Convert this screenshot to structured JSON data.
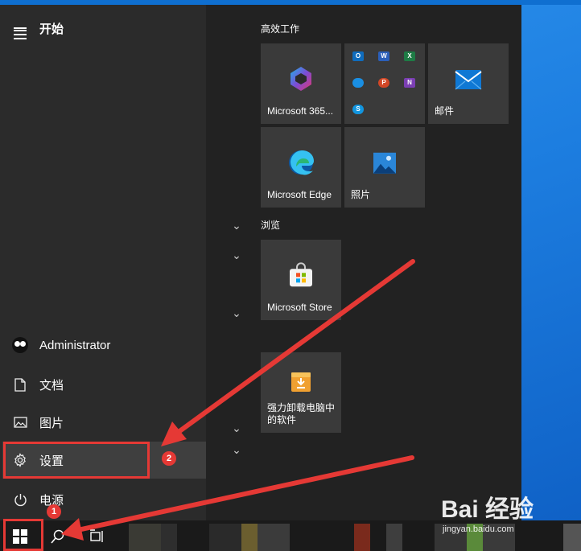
{
  "start_menu": {
    "title": "开始",
    "user": "Administrator",
    "items": [
      {
        "label": "文档",
        "icon": "document-icon"
      },
      {
        "label": "图片",
        "icon": "picture-icon"
      },
      {
        "label": "设置",
        "icon": "gear-icon"
      },
      {
        "label": "电源",
        "icon": "power-icon"
      }
    ]
  },
  "groups": [
    {
      "title": "高效工作"
    },
    {
      "title": "浏览"
    }
  ],
  "tiles": [
    {
      "name": "Microsoft 365...",
      "icon": "microsoft-365-icon"
    },
    {
      "name": "",
      "icon": "office-apps-group-icon"
    },
    {
      "name": "邮件",
      "icon": "mail-icon"
    },
    {
      "name": "Microsoft Edge",
      "icon": "edge-icon"
    },
    {
      "name": "照片",
      "icon": "photos-icon"
    },
    {
      "name": "Microsoft Store",
      "icon": "store-icon"
    },
    {
      "name": "强力卸载电脑中的软件",
      "icon": "uninstaller-icon"
    }
  ],
  "annotations": {
    "badge_1": "1",
    "badge_2": "2",
    "arrow_color": "#e53935"
  },
  "watermark": {
    "brand": "Bai 经验",
    "url": "jingyan.baidu.com"
  },
  "colors": {
    "menu_bg": "#2b2b2b",
    "tiles_bg": "#222222",
    "tile": "#3a3a3a",
    "highlight": "#e53935"
  }
}
